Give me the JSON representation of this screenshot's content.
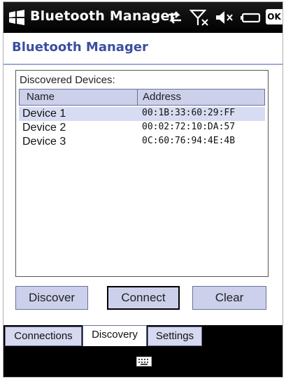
{
  "titlebar": {
    "title": "Bluetooth Manager",
    "ok_label": "OK"
  },
  "app": {
    "title": "Bluetooth Manager"
  },
  "list": {
    "caption": "Discovered  Devices:",
    "columns": {
      "name": "Name",
      "address": "Address"
    },
    "rows": [
      {
        "name": "Device 1",
        "address": "00:1B:33:60:29:FF",
        "selected": true
      },
      {
        "name": "Device 2",
        "address": "00:02:72:10:DA:57",
        "selected": false
      },
      {
        "name": "Device 3",
        "address": "0C:60:76:94:4E:4B",
        "selected": false
      }
    ]
  },
  "buttons": {
    "discover": "Discover",
    "connect": "Connect",
    "clear": "Clear"
  },
  "tabs": [
    {
      "label": "Connections",
      "active": false
    },
    {
      "label": "Discovery",
      "active": true
    },
    {
      "label": "Settings",
      "active": false
    }
  ],
  "icons": {
    "start": "windows-flag-icon",
    "connectivity": "data-arrows-icon",
    "signal": "no-signal-icon",
    "volume": "mute-speaker-icon",
    "battery": "battery-icon",
    "keyboard": "keyboard-icon"
  },
  "colors": {
    "title_bg": "#000000",
    "accent": "#3a4fa0",
    "control_bg": "#ccd0ea",
    "selection": "#d8dcf2"
  }
}
